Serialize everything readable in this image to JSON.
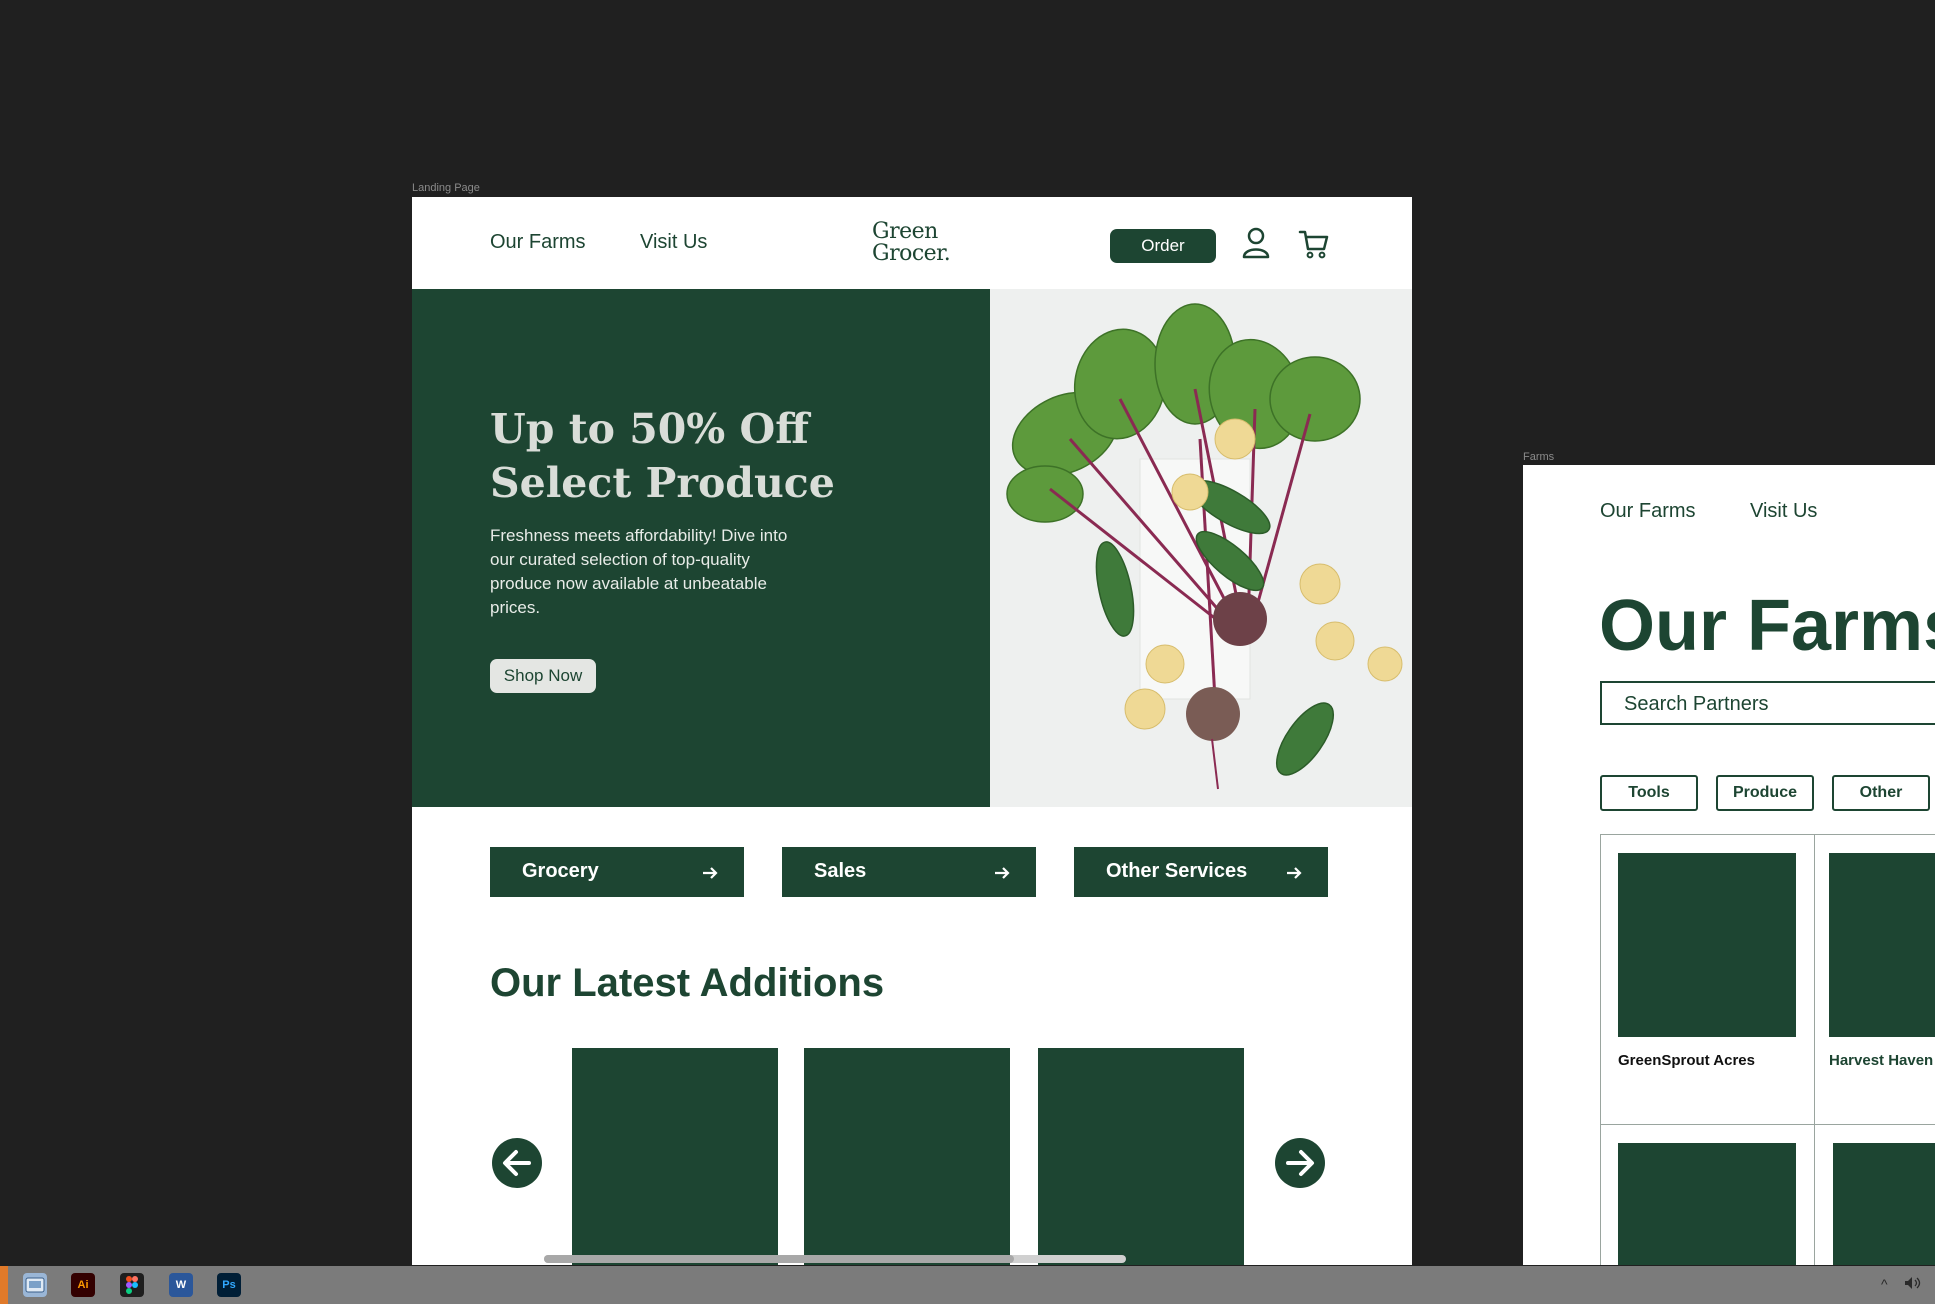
{
  "canvas": {
    "landing_frame_label": "Landing Page",
    "farms_frame_label": "Farms"
  },
  "landing": {
    "nav": {
      "our_farms": "Our Farms",
      "visit_us": "Visit Us",
      "logo_line1": "Green",
      "logo_line2": "Grocer.",
      "order": "Order",
      "account_icon": "user-icon",
      "cart_icon": "cart-icon"
    },
    "hero": {
      "title_line1": "Up to 50% Off",
      "title_line2": "Select Produce",
      "description": "Freshness meets affordability! Dive into our curated selection of top-quality produce now available at unbeatable prices.",
      "cta": "Shop Now",
      "image_subject": "beets, cucumbers and small potatoes on white surface"
    },
    "categories": [
      {
        "label": "Grocery"
      },
      {
        "label": "Sales"
      },
      {
        "label": "Other Services"
      }
    ],
    "latest": {
      "title": "Our Latest Additions"
    }
  },
  "farms": {
    "nav": {
      "our_farms": "Our Farms",
      "visit_us": "Visit Us"
    },
    "title": "Our Farms",
    "search_placeholder": "Search Partners",
    "filters": [
      "Tools",
      "Produce",
      "Other"
    ],
    "partners": [
      {
        "name": "GreenSprout Acres"
      },
      {
        "name": "Harvest Haven"
      }
    ]
  },
  "colors": {
    "brand_green": "#1d4532",
    "canvas_bg": "#202020",
    "taskbar_bg": "#7b7b7b"
  },
  "taskbar": {
    "apps": [
      "finder-icon",
      "illustrator-icon",
      "figma-icon",
      "word-icon",
      "photoshop-icon"
    ]
  }
}
